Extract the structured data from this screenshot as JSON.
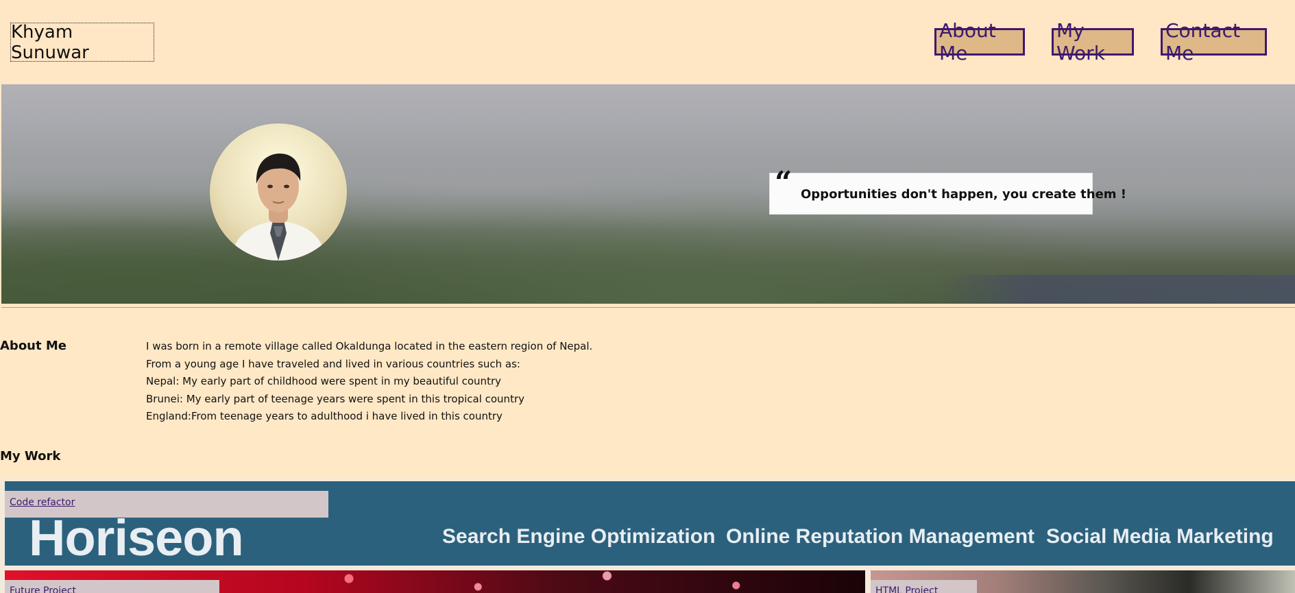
{
  "header": {
    "brand": "Khyam Sunuwar",
    "nav": [
      {
        "label": "About Me"
      },
      {
        "label": "My Work"
      },
      {
        "label": "Contact Me"
      }
    ]
  },
  "hero": {
    "quote": "Opportunities don't happen, you create them !",
    "quote_mark": "“"
  },
  "about": {
    "heading": "About Me",
    "lines": [
      "I was born in a remote village called Okaldunga located in the eastern region of Nepal.",
      "From a young age I have traveled and lived in various countries such as:",
      "Nepal: My early part of childhood were spent in my beautiful country",
      "Brunei: My early part of teenage years were spent in this tropical country",
      "England:From teenage years to adulthood i have lived in this country"
    ]
  },
  "work": {
    "heading": "My Work",
    "projects": [
      {
        "label": "Code refactor",
        "image_text": {
          "logo": "Horiseon",
          "nav": [
            "Search Engine Optimization",
            "Online Reputation Management",
            "Social Media Marketing"
          ]
        }
      },
      {
        "label": "Future Project"
      },
      {
        "label": "HTML Project"
      }
    ]
  },
  "colors": {
    "background": "#ffe8c6",
    "nav_border": "#42166f",
    "nav_fill": "#deb887",
    "link": "#3b1a6c",
    "horiseon_blue": "#2c617d"
  }
}
